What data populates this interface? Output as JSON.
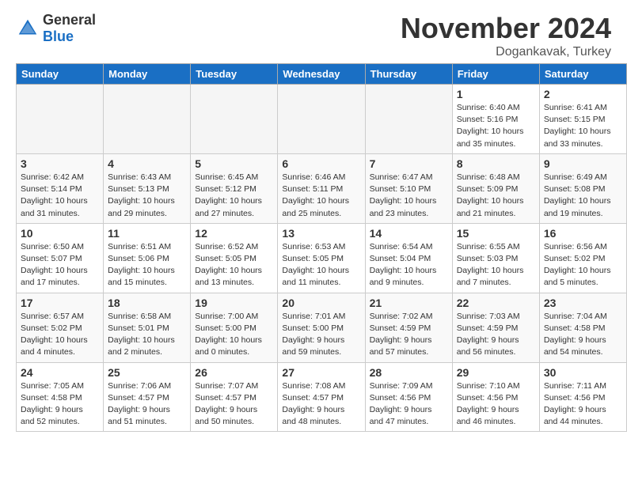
{
  "logo": {
    "general": "General",
    "blue": "Blue"
  },
  "header": {
    "month_title": "November 2024",
    "location": "Dogankavak, Turkey"
  },
  "days_of_week": [
    "Sunday",
    "Monday",
    "Tuesday",
    "Wednesday",
    "Thursday",
    "Friday",
    "Saturday"
  ],
  "weeks": [
    [
      {
        "num": "",
        "info": "",
        "empty": true
      },
      {
        "num": "",
        "info": "",
        "empty": true
      },
      {
        "num": "",
        "info": "",
        "empty": true
      },
      {
        "num": "",
        "info": "",
        "empty": true
      },
      {
        "num": "",
        "info": "",
        "empty": true
      },
      {
        "num": "1",
        "info": "Sunrise: 6:40 AM\nSunset: 5:16 PM\nDaylight: 10 hours\nand 35 minutes.",
        "empty": false
      },
      {
        "num": "2",
        "info": "Sunrise: 6:41 AM\nSunset: 5:15 PM\nDaylight: 10 hours\nand 33 minutes.",
        "empty": false
      }
    ],
    [
      {
        "num": "3",
        "info": "Sunrise: 6:42 AM\nSunset: 5:14 PM\nDaylight: 10 hours\nand 31 minutes.",
        "empty": false
      },
      {
        "num": "4",
        "info": "Sunrise: 6:43 AM\nSunset: 5:13 PM\nDaylight: 10 hours\nand 29 minutes.",
        "empty": false
      },
      {
        "num": "5",
        "info": "Sunrise: 6:45 AM\nSunset: 5:12 PM\nDaylight: 10 hours\nand 27 minutes.",
        "empty": false
      },
      {
        "num": "6",
        "info": "Sunrise: 6:46 AM\nSunset: 5:11 PM\nDaylight: 10 hours\nand 25 minutes.",
        "empty": false
      },
      {
        "num": "7",
        "info": "Sunrise: 6:47 AM\nSunset: 5:10 PM\nDaylight: 10 hours\nand 23 minutes.",
        "empty": false
      },
      {
        "num": "8",
        "info": "Sunrise: 6:48 AM\nSunset: 5:09 PM\nDaylight: 10 hours\nand 21 minutes.",
        "empty": false
      },
      {
        "num": "9",
        "info": "Sunrise: 6:49 AM\nSunset: 5:08 PM\nDaylight: 10 hours\nand 19 minutes.",
        "empty": false
      }
    ],
    [
      {
        "num": "10",
        "info": "Sunrise: 6:50 AM\nSunset: 5:07 PM\nDaylight: 10 hours\nand 17 minutes.",
        "empty": false
      },
      {
        "num": "11",
        "info": "Sunrise: 6:51 AM\nSunset: 5:06 PM\nDaylight: 10 hours\nand 15 minutes.",
        "empty": false
      },
      {
        "num": "12",
        "info": "Sunrise: 6:52 AM\nSunset: 5:05 PM\nDaylight: 10 hours\nand 13 minutes.",
        "empty": false
      },
      {
        "num": "13",
        "info": "Sunrise: 6:53 AM\nSunset: 5:05 PM\nDaylight: 10 hours\nand 11 minutes.",
        "empty": false
      },
      {
        "num": "14",
        "info": "Sunrise: 6:54 AM\nSunset: 5:04 PM\nDaylight: 10 hours\nand 9 minutes.",
        "empty": false
      },
      {
        "num": "15",
        "info": "Sunrise: 6:55 AM\nSunset: 5:03 PM\nDaylight: 10 hours\nand 7 minutes.",
        "empty": false
      },
      {
        "num": "16",
        "info": "Sunrise: 6:56 AM\nSunset: 5:02 PM\nDaylight: 10 hours\nand 5 minutes.",
        "empty": false
      }
    ],
    [
      {
        "num": "17",
        "info": "Sunrise: 6:57 AM\nSunset: 5:02 PM\nDaylight: 10 hours\nand 4 minutes.",
        "empty": false
      },
      {
        "num": "18",
        "info": "Sunrise: 6:58 AM\nSunset: 5:01 PM\nDaylight: 10 hours\nand 2 minutes.",
        "empty": false
      },
      {
        "num": "19",
        "info": "Sunrise: 7:00 AM\nSunset: 5:00 PM\nDaylight: 10 hours\nand 0 minutes.",
        "empty": false
      },
      {
        "num": "20",
        "info": "Sunrise: 7:01 AM\nSunset: 5:00 PM\nDaylight: 9 hours\nand 59 minutes.",
        "empty": false
      },
      {
        "num": "21",
        "info": "Sunrise: 7:02 AM\nSunset: 4:59 PM\nDaylight: 9 hours\nand 57 minutes.",
        "empty": false
      },
      {
        "num": "22",
        "info": "Sunrise: 7:03 AM\nSunset: 4:59 PM\nDaylight: 9 hours\nand 56 minutes.",
        "empty": false
      },
      {
        "num": "23",
        "info": "Sunrise: 7:04 AM\nSunset: 4:58 PM\nDaylight: 9 hours\nand 54 minutes.",
        "empty": false
      }
    ],
    [
      {
        "num": "24",
        "info": "Sunrise: 7:05 AM\nSunset: 4:58 PM\nDaylight: 9 hours\nand 52 minutes.",
        "empty": false
      },
      {
        "num": "25",
        "info": "Sunrise: 7:06 AM\nSunset: 4:57 PM\nDaylight: 9 hours\nand 51 minutes.",
        "empty": false
      },
      {
        "num": "26",
        "info": "Sunrise: 7:07 AM\nSunset: 4:57 PM\nDaylight: 9 hours\nand 50 minutes.",
        "empty": false
      },
      {
        "num": "27",
        "info": "Sunrise: 7:08 AM\nSunset: 4:57 PM\nDaylight: 9 hours\nand 48 minutes.",
        "empty": false
      },
      {
        "num": "28",
        "info": "Sunrise: 7:09 AM\nSunset: 4:56 PM\nDaylight: 9 hours\nand 47 minutes.",
        "empty": false
      },
      {
        "num": "29",
        "info": "Sunrise: 7:10 AM\nSunset: 4:56 PM\nDaylight: 9 hours\nand 46 minutes.",
        "empty": false
      },
      {
        "num": "30",
        "info": "Sunrise: 7:11 AM\nSunset: 4:56 PM\nDaylight: 9 hours\nand 44 minutes.",
        "empty": false
      }
    ]
  ]
}
